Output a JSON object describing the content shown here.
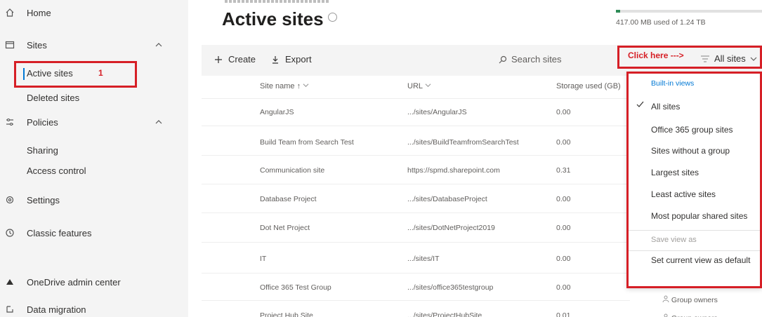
{
  "sidebar": {
    "home": "Home",
    "sites": "Sites",
    "active_sites": "Active sites",
    "deleted_sites": "Deleted sites",
    "policies": "Policies",
    "sharing": "Sharing",
    "access_control": "Access control",
    "settings": "Settings",
    "classic_features": "Classic features",
    "onedrive": "OneDrive admin center",
    "data_migration": "Data migration",
    "annotation_number": "1"
  },
  "header": {
    "title": "Active sites",
    "storage_text": "417.00 MB used of 1.24 TB",
    "storage_fraction": 0.03
  },
  "commandbar": {
    "create": "Create",
    "export": "Export",
    "search_placeholder": "Search sites",
    "annotation": "Click here --->",
    "view_selector": "All sites"
  },
  "table": {
    "columns": [
      "Site name ↑",
      "URL",
      "Storage used (GB)"
    ],
    "rows": [
      [
        "AngularJS",
        ".../sites/AngularJS",
        "0.00"
      ],
      [
        "Build Team from Search Test",
        ".../sites/BuildTeamfromSearchTest",
        "0.00"
      ],
      [
        "Communication site",
        "https://spmd.sharepoint.com",
        "0.31"
      ],
      [
        "Database Project",
        ".../sites/DatabaseProject",
        "0.00"
      ],
      [
        "Dot Net Project",
        ".../sites/DotNetProject2019",
        "0.00"
      ],
      [
        "IT",
        ".../sites/IT",
        "0.00"
      ],
      [
        "Office 365 Test Group",
        ".../sites/office365testgroup",
        "0.00"
      ],
      [
        "Project Hub Site",
        ".../sites/ProjectHubSite",
        "0.01"
      ]
    ],
    "owner_label": "Group owners"
  },
  "view_menu": {
    "header": "Built-in views",
    "items": [
      "All sites",
      "Office 365 group sites",
      "Sites without a group",
      "Largest sites",
      "Least active sites",
      "Most popular shared sites"
    ],
    "save_view": "Save view as",
    "set_default": "Set current view as default"
  },
  "colors": {
    "accent": "#0078d4",
    "annotation": "#d61f26"
  }
}
